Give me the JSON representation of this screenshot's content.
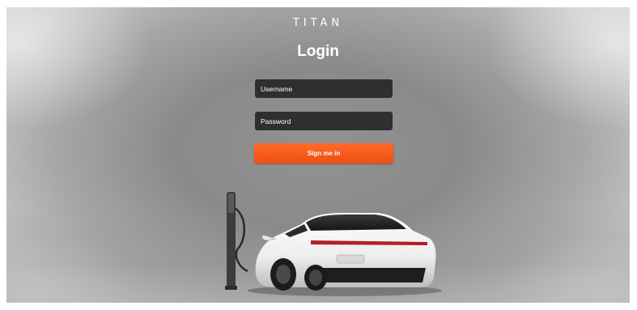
{
  "header": {
    "brand": "TITAN",
    "title": "Login"
  },
  "form": {
    "username_placeholder": "Username",
    "password_placeholder": "Password",
    "submit_label": "Sign me in"
  },
  "colors": {
    "accent": "#f25a1a",
    "field_bg": "#2f2f2f",
    "text": "#ffffff"
  }
}
